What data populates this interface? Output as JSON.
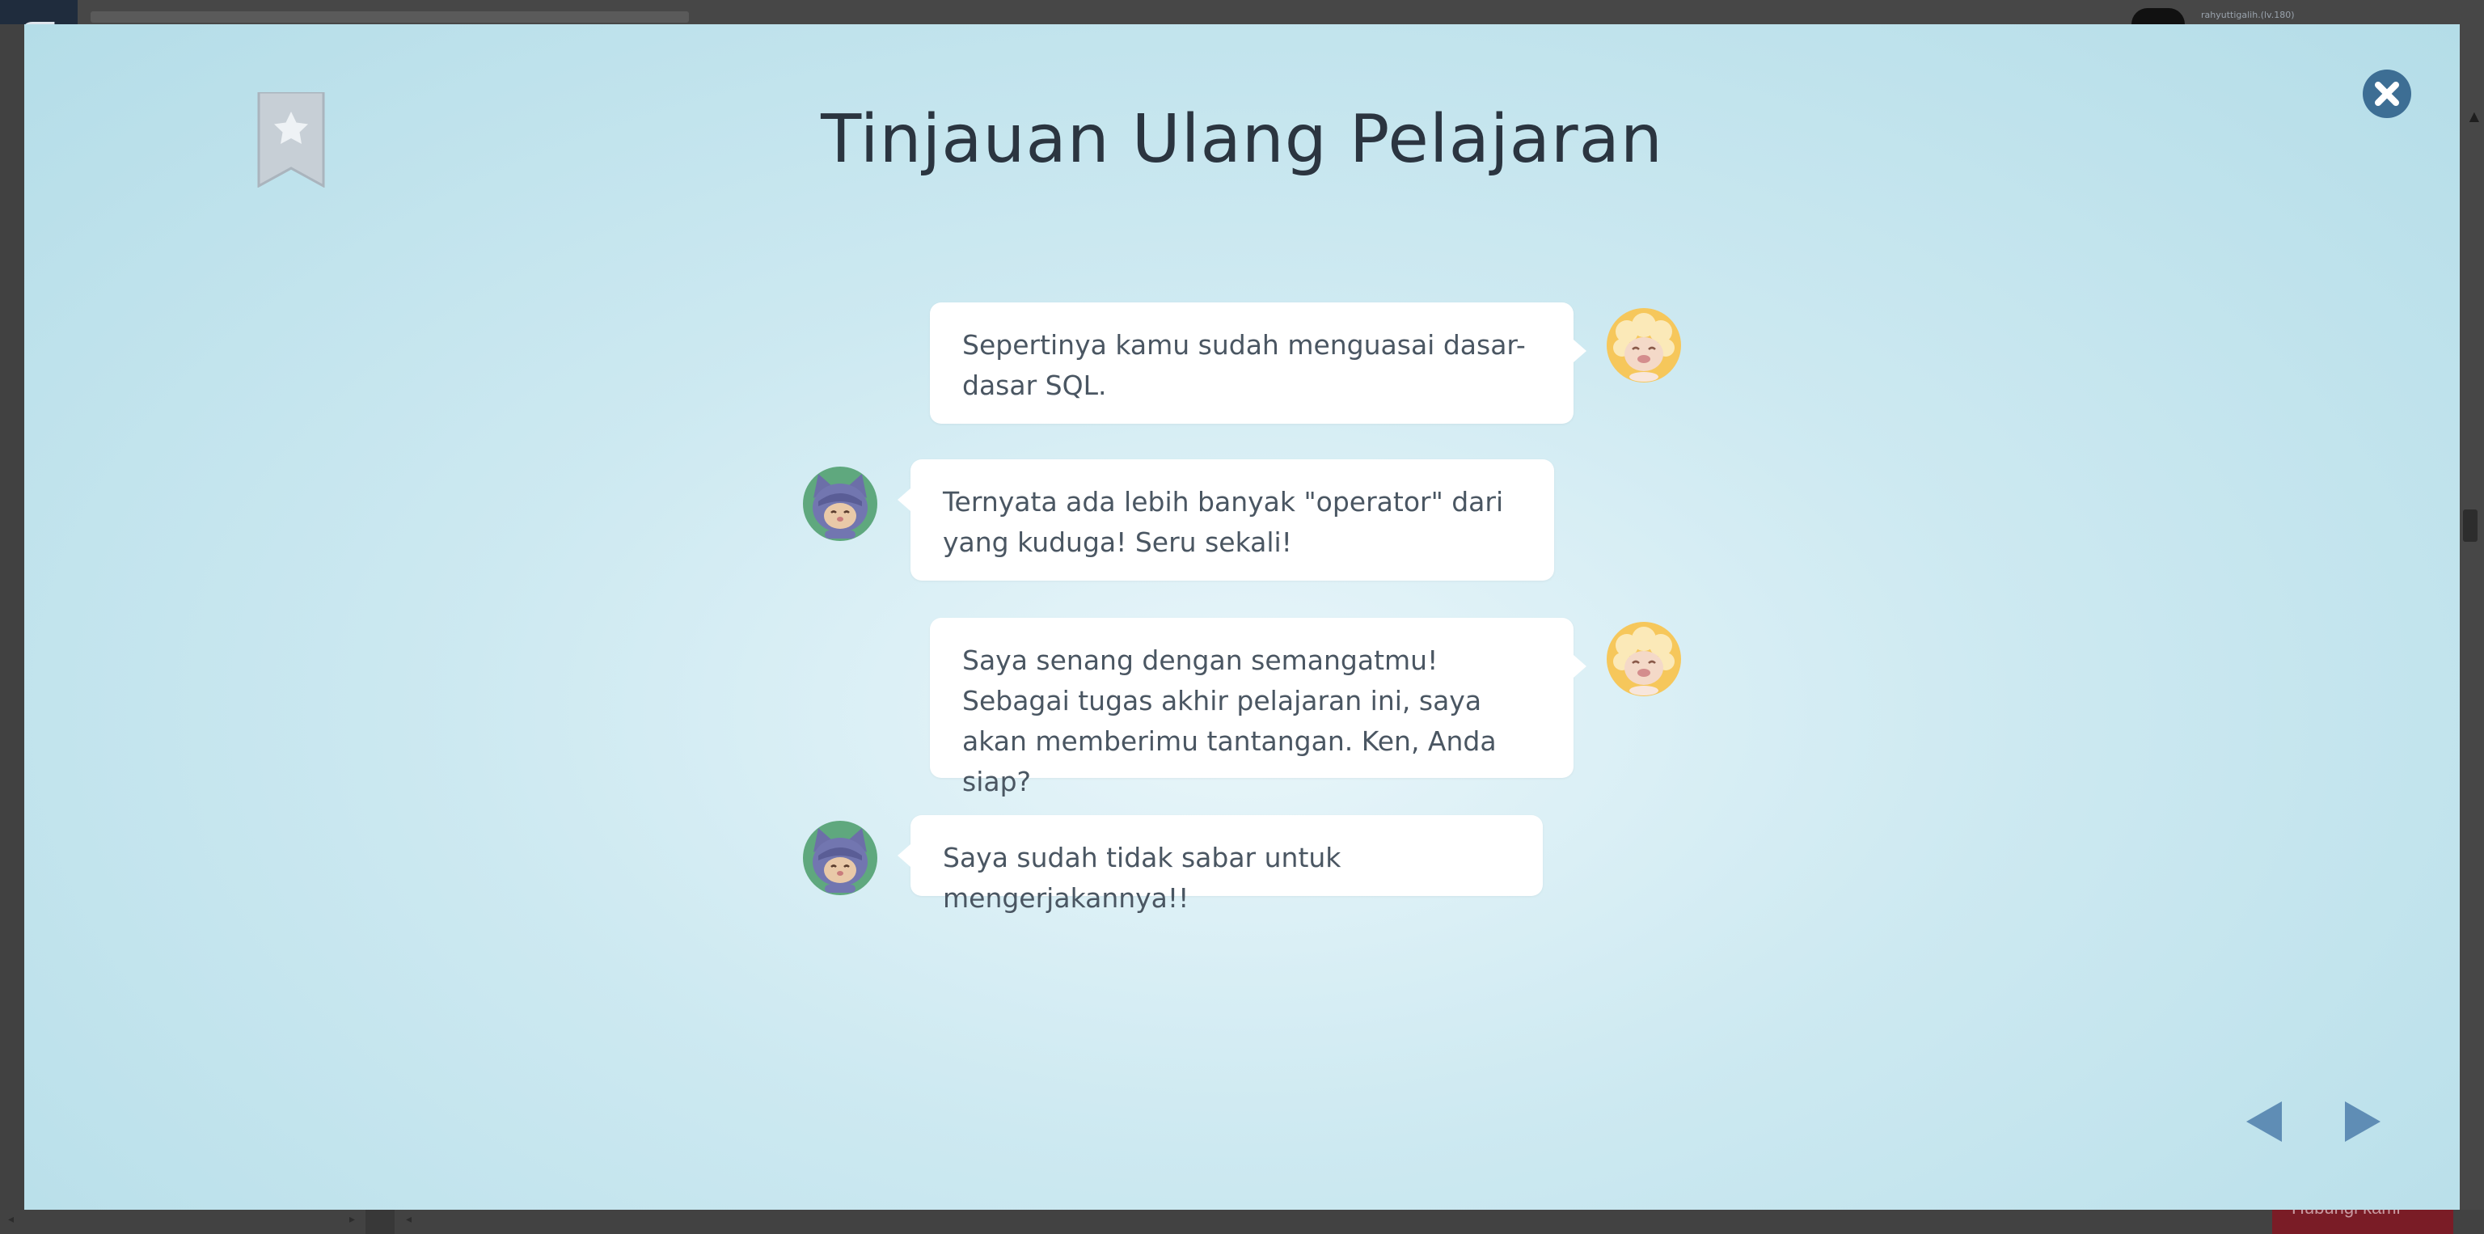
{
  "background": {
    "app_logo_glyph": "Ԙ",
    "user_label": "rahyuttigalih.(lv.180)",
    "feedback_label": "Hubungi kami",
    "modal_bg": "#cde9f1",
    "bookmark_color": "#c7cfd6",
    "close_color": "#3d6e94",
    "arrow_color": "#5f8db5"
  },
  "modal": {
    "title": "Tinjauan Ulang Pelajaran",
    "bookmark_icon": "bookmark-star-icon",
    "close_icon": "close-icon",
    "prev_icon": "triangle-left-icon",
    "next_icon": "triangle-right-icon"
  },
  "dialogue": [
    {
      "speaker": "sheep",
      "side": "right",
      "text": "Sepertinya kamu sudah menguasai dasar-dasar SQL."
    },
    {
      "speaker": "cat",
      "side": "left",
      "text": "Ternyata ada lebih banyak \"operator\" dari yang kuduga! Seru sekali!"
    },
    {
      "speaker": "sheep",
      "side": "right",
      "text": "Saya senang dengan semangatmu! Sebagai tugas akhir pelajaran ini, saya akan memberimu tantangan. Ken, Anda siap?"
    },
    {
      "speaker": "cat",
      "side": "left",
      "text": "Saya sudah tidak sabar untuk mengerjakannya!!"
    }
  ]
}
